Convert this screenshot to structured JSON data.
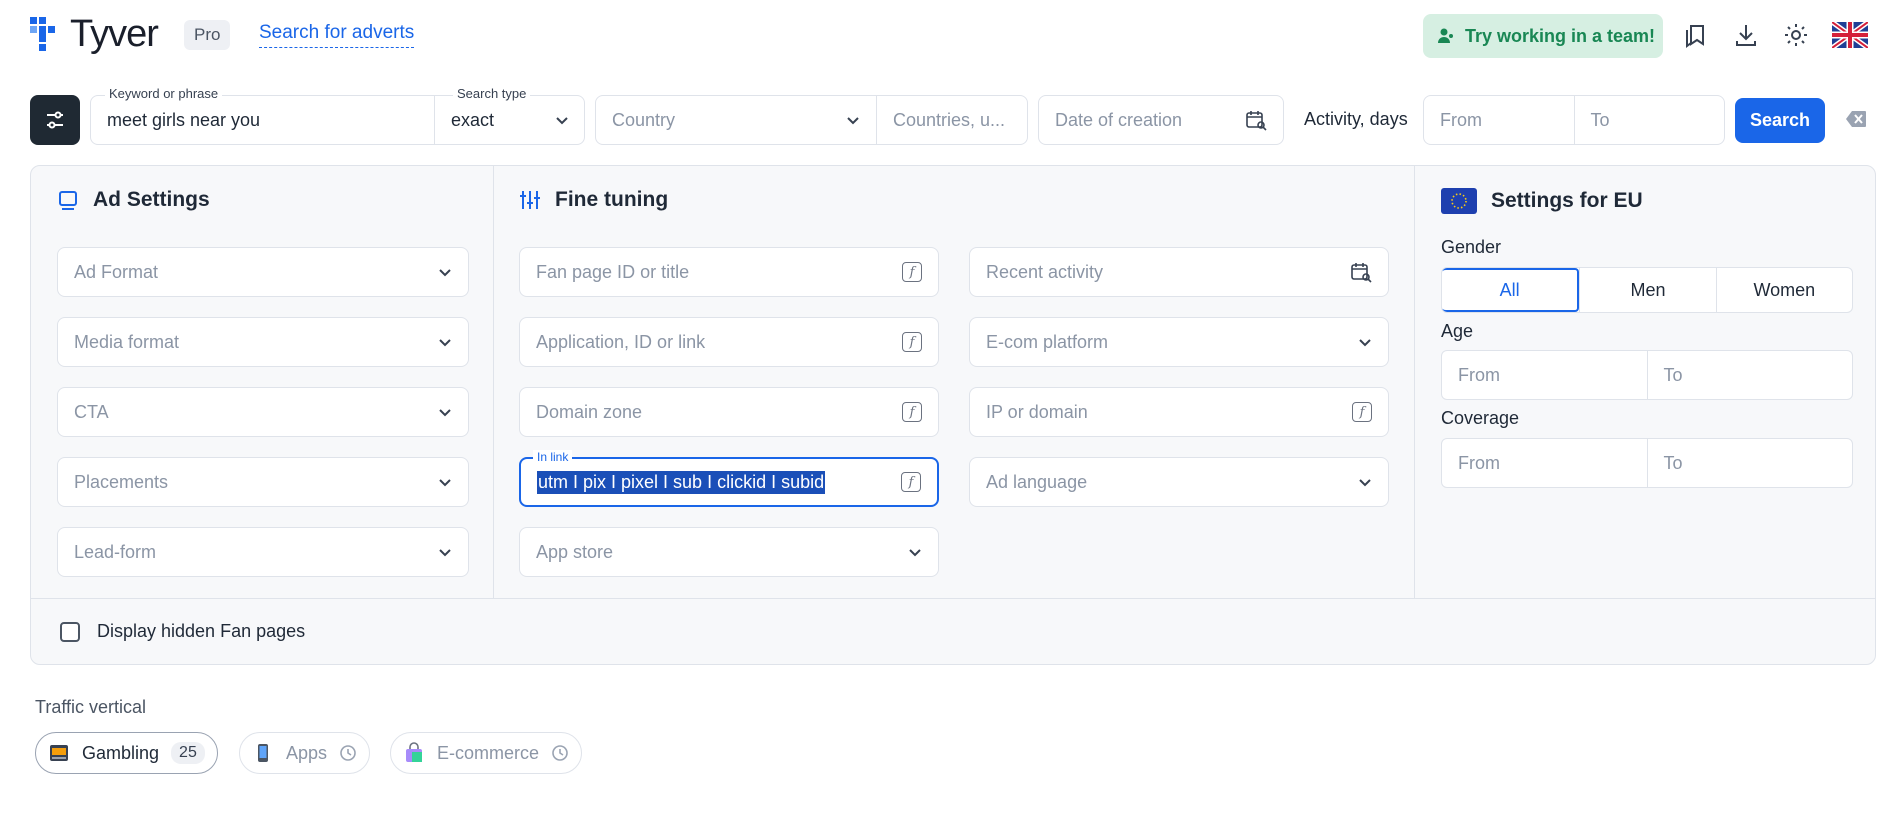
{
  "header": {
    "brand": "Tyver",
    "plan_badge": "Pro",
    "search_link": "Search for adverts",
    "team_button": "Try working in a team!",
    "icons": [
      "bookmarks-icon",
      "download-icon",
      "settings-icon",
      "uk-flag-icon"
    ]
  },
  "searchbar": {
    "keyword_label": "Keyword or phrase",
    "keyword_value": "meet girls near you",
    "search_type_label": "Search type",
    "search_type_value": "exact",
    "country_placeholder": "Country",
    "countries_placeholder": "Countries, u...",
    "date_placeholder": "Date of creation",
    "activity_label": "Activity, days",
    "from_placeholder": "From",
    "to_placeholder": "To",
    "search_button": "Search"
  },
  "ad_settings": {
    "title": "Ad Settings",
    "fields": [
      "Ad Format",
      "Media format",
      "CTA",
      "Placements",
      "Lead-form"
    ]
  },
  "fine_tuning": {
    "title": "Fine tuning",
    "left": [
      "Fan page ID or title",
      "Application, ID or link",
      "Domain zone"
    ],
    "in_link_label": "In link",
    "in_link_value": "utm I pix I pixel I sub I clickid I subid",
    "app_store": "App store",
    "right": [
      "Recent activity",
      "E-com platform",
      "IP or domain",
      "Ad language"
    ]
  },
  "eu_settings": {
    "title": "Settings for EU",
    "gender_label": "Gender",
    "gender_options": [
      "All",
      "Men",
      "Women"
    ],
    "gender_selected": "All",
    "age_label": "Age",
    "coverage_label": "Coverage",
    "from": "From",
    "to": "To"
  },
  "hidden_fan_pages": "Display hidden Fan pages",
  "traffic": {
    "label": "Traffic vertical",
    "chips": [
      {
        "label": "Gambling",
        "badge": "25",
        "icon": "slot-machine-icon"
      },
      {
        "label": "Apps",
        "icon": "phone-icon"
      },
      {
        "label": "E-commerce",
        "icon": "shopping-bag-icon"
      }
    ]
  },
  "colors": {
    "accent": "#1a66e8",
    "team_bg": "#d6efe2",
    "team_text": "#198754",
    "dark_btn": "#1f2933"
  }
}
